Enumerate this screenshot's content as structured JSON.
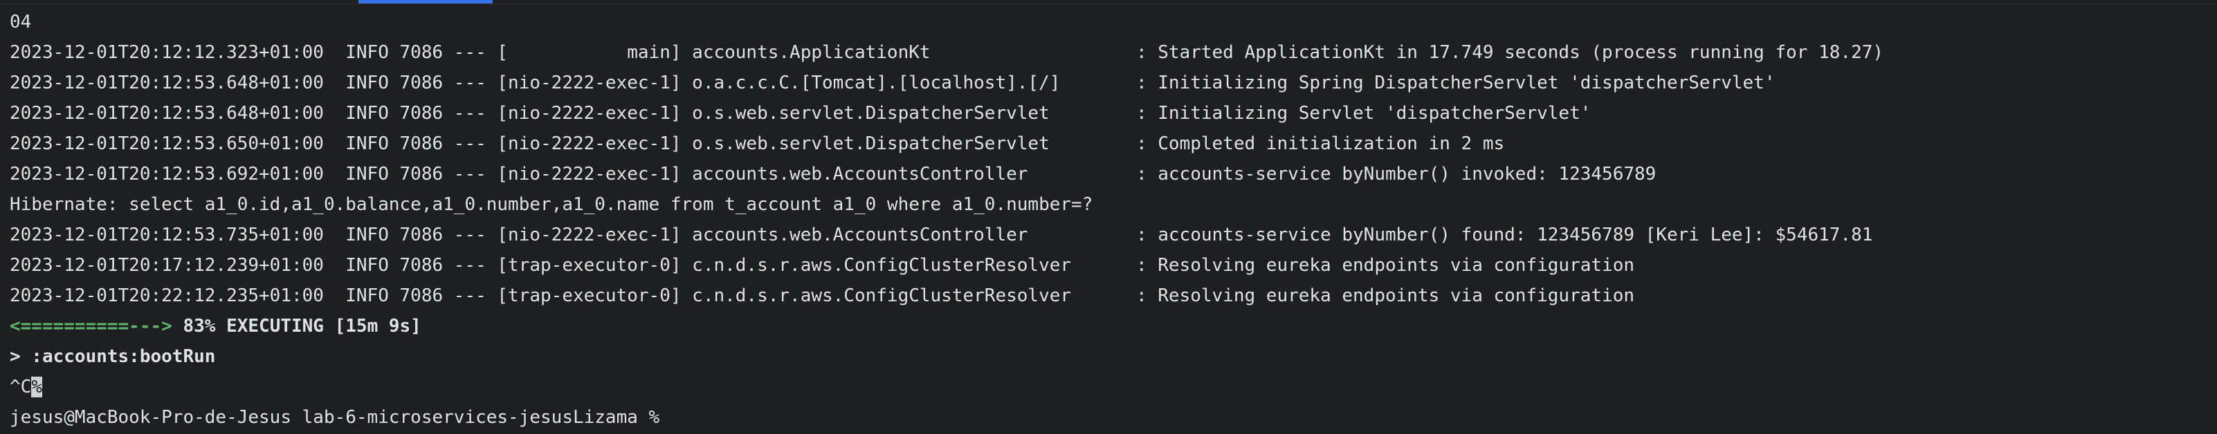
{
  "terminal": {
    "lines": [
      "04",
      "2023-12-01T20:12:12.323+01:00  INFO 7086 --- [           main] accounts.ApplicationKt                   : Started ApplicationKt in 17.749 seconds (process running for 18.27)",
      "2023-12-01T20:12:53.648+01:00  INFO 7086 --- [nio-2222-exec-1] o.a.c.c.C.[Tomcat].[localhost].[/]       : Initializing Spring DispatcherServlet 'dispatcherServlet'",
      "2023-12-01T20:12:53.648+01:00  INFO 7086 --- [nio-2222-exec-1] o.s.web.servlet.DispatcherServlet        : Initializing Servlet 'dispatcherServlet'",
      "2023-12-01T20:12:53.650+01:00  INFO 7086 --- [nio-2222-exec-1] o.s.web.servlet.DispatcherServlet        : Completed initialization in 2 ms",
      "2023-12-01T20:12:53.692+01:00  INFO 7086 --- [nio-2222-exec-1] accounts.web.AccountsController          : accounts-service byNumber() invoked: 123456789",
      "Hibernate: select a1_0.id,a1_0.balance,a1_0.number,a1_0.name from t_account a1_0 where a1_0.number=?",
      "2023-12-01T20:12:53.735+01:00  INFO 7086 --- [nio-2222-exec-1] accounts.web.AccountsController          : accounts-service byNumber() found: 123456789 [Keri Lee]: $54617.81",
      "2023-12-01T20:17:12.239+01:00  INFO 7086 --- [trap-executor-0] c.n.d.s.r.aws.ConfigClusterResolver      : Resolving eureka endpoints via configuration",
      "2023-12-01T20:22:12.235+01:00  INFO 7086 --- [trap-executor-0] c.n.d.s.r.aws.ConfigClusterResolver      : Resolving eureka endpoints via configuration"
    ],
    "progress": {
      "bar": "<==========--->",
      "status": " 83% EXECUTING [15m 9s]"
    },
    "task_line": "> :accounts:bootRun",
    "interrupt": {
      "text": "^C",
      "cursor": "%"
    },
    "prompt": "jesus@MacBook-Pro-de-Jesus lab-6-microservices-jesusLizama % "
  },
  "colors": {
    "background": "#1e1f22",
    "foreground": "#dfe1e5",
    "progress_bar": "#5fb865",
    "tab_accent": "#3574f0"
  }
}
